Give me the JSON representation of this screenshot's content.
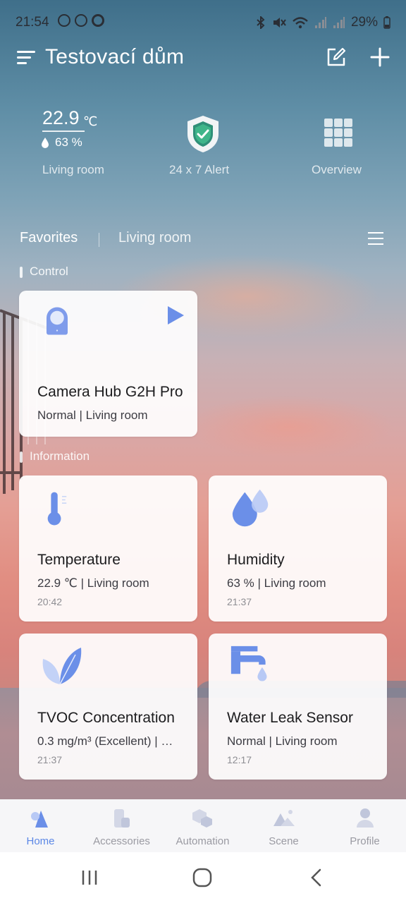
{
  "status_bar": {
    "time": "21:54",
    "battery": "29%",
    "left_icons": [
      "vpn-icon",
      "sync-icon",
      "messenger-icon"
    ],
    "right_icons": [
      "bluetooth-icon",
      "mute-icon",
      "wifi-icon",
      "signal-icon",
      "signal-icon",
      "battery-icon"
    ]
  },
  "header": {
    "title": "Testovací dům",
    "menu_icon": "hamburger-menu-icon",
    "edit_icon": "edit-icon",
    "add_icon": "plus-icon"
  },
  "summary": {
    "temperature": "22.9",
    "temperature_unit": "℃",
    "humidity": "63 %",
    "room_label": "Living room",
    "alert_label": "24 x 7 Alert",
    "overview_label": "Overview"
  },
  "tabs": {
    "favorites": "Favorites",
    "living_room": "Living room"
  },
  "sections": {
    "control": "Control",
    "information": "Information"
  },
  "control_cards": [
    {
      "title": "Camera Hub G2H Pro",
      "subtitle": "Normal  |  Living room",
      "icon": "camera-hub-icon",
      "action_icon": "play-icon"
    }
  ],
  "info_cards": [
    {
      "title": "Temperature",
      "subtitle": "22.9 ℃  |  Living room",
      "time": "20:42",
      "icon": "thermometer-icon"
    },
    {
      "title": "Humidity",
      "subtitle": "63 %  |  Living room",
      "time": "21:37",
      "icon": "humidity-drops-icon"
    },
    {
      "title": "TVOC Concentration",
      "subtitle": "0.3  mg/m³ (Excellent)  |  …",
      "time": "21:37",
      "icon": "leaf-icon"
    },
    {
      "title": "Water Leak Sensor",
      "subtitle": "Normal  |  Living room",
      "time": "12:17",
      "icon": "faucet-icon"
    }
  ],
  "bottom_nav": [
    {
      "label": "Home",
      "active": true,
      "icon": "home-icon"
    },
    {
      "label": "Accessories",
      "active": false,
      "icon": "accessories-icon"
    },
    {
      "label": "Automation",
      "active": false,
      "icon": "automation-icon"
    },
    {
      "label": "Scene",
      "active": false,
      "icon": "scene-icon"
    },
    {
      "label": "Profile",
      "active": false,
      "icon": "profile-icon"
    }
  ],
  "colors": {
    "accent": "#5b87e6",
    "icon_blue": "#6b8fe8",
    "card_bg": "#ffffff",
    "shield_green": "#3fb58a"
  }
}
